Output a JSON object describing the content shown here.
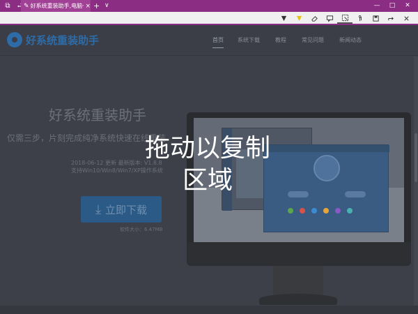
{
  "browser": {
    "tab_title": "好系统重装助手,电脑一键",
    "tab_close": "×",
    "new_tab": "+",
    "tab_menu": "∨",
    "window_btns": [
      "⧉",
      "⮐"
    ],
    "sys_btns": [
      "—",
      "□",
      "✕"
    ]
  },
  "site": {
    "logo_text": "好系统重装助手",
    "nav": [
      "首页",
      "系统下载",
      "教程",
      "常见问题",
      "新闻动态"
    ]
  },
  "hero": {
    "title": "好系统重装助手",
    "subtitle": "仅需三步，片刻完成纯净系统快速在线重装",
    "date_line": "2018-06-12 更新 最新版本: V1.8.8",
    "support_line": "支持Win10/Win8/Win7/XP操作系统",
    "download_label": "立即下载",
    "download_icon": "download-arrow",
    "size_line": "软件大小：6.47MB"
  },
  "overlay": {
    "line1": "拖动以复制",
    "line2": "区域"
  },
  "colors": {
    "accent": "#8b2d82",
    "page_bg": "#3d4049",
    "download_btn": "#2c5a86",
    "logo": "#2e6ca8"
  }
}
